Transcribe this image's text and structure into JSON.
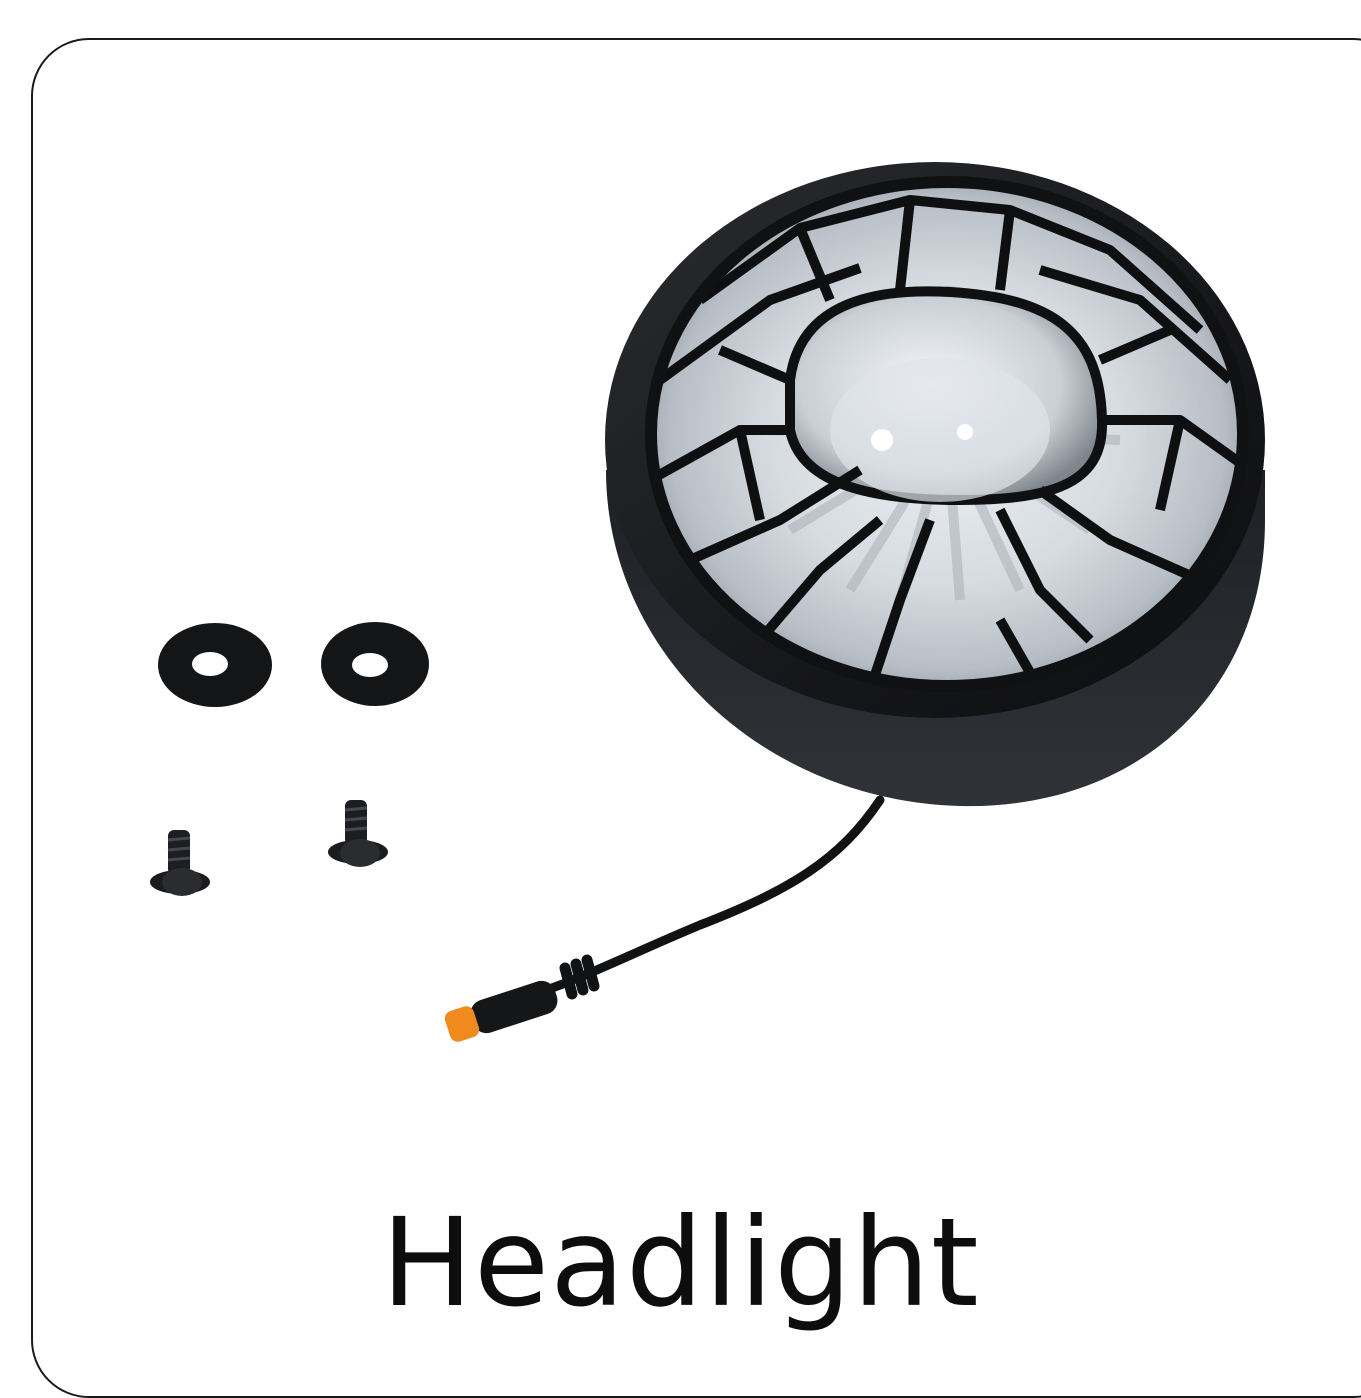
{
  "product": {
    "caption": "Headlight",
    "items": [
      "headlight-unit",
      "rubber-washer",
      "rubber-washer",
      "mounting-bolt",
      "mounting-bolt",
      "connector-cable"
    ]
  },
  "colors": {
    "background": "#ffffff",
    "frame_border": "#1a1a1a",
    "housing": "#1b1c1f",
    "lens": "#d9dde2",
    "connector": "#f08a1c",
    "caption_text": "#0d0d0d"
  }
}
